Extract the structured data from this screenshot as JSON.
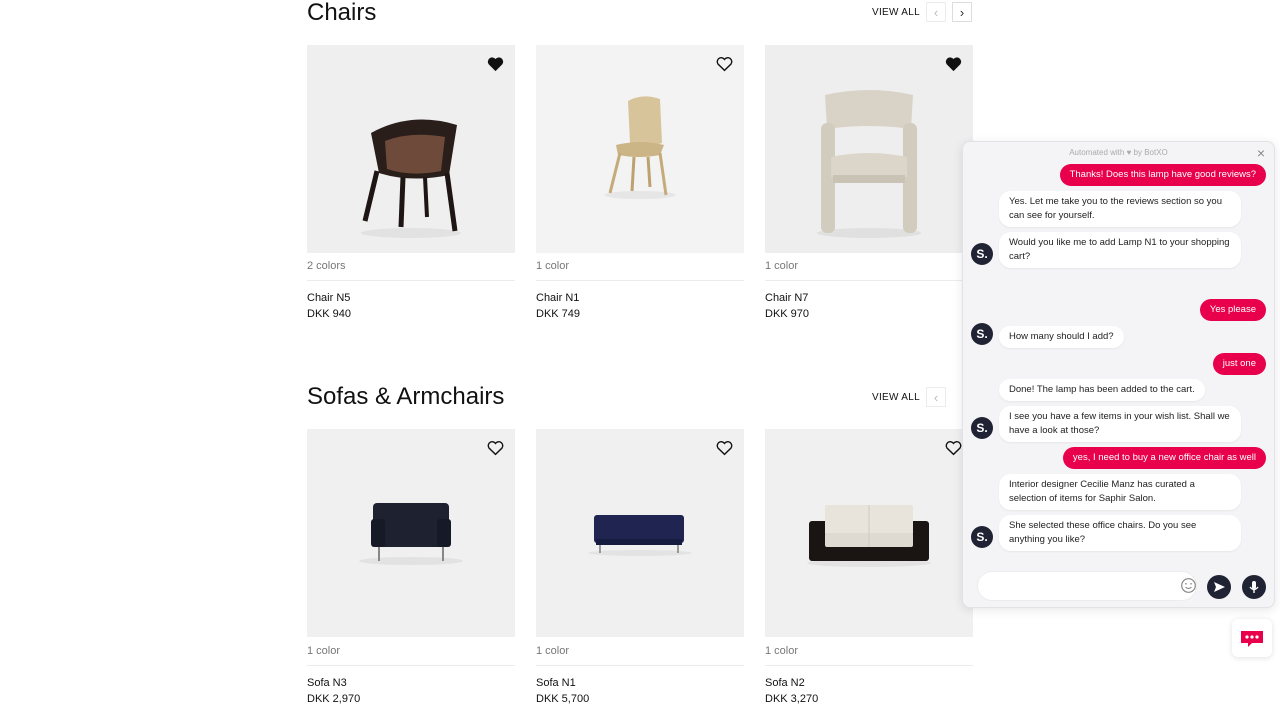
{
  "colors": {
    "accent": "#e8004d",
    "dark": "#1f2333",
    "card_bg": "#f0f0f0"
  },
  "chairs": {
    "title": "Chairs",
    "view_all": "VIEW ALL",
    "prev_icon": "chevron-left-icon",
    "next_icon": "chevron-right-icon",
    "products": [
      {
        "colors": "2 colors",
        "name": "Chair N5",
        "price": "DKK 940",
        "favorited": true
      },
      {
        "colors": "1 color",
        "name": "Chair N1",
        "price": "DKK 749",
        "favorited": false
      },
      {
        "colors": "1 color",
        "name": "Chair N7",
        "price": "DKK 970",
        "favorited": true
      }
    ]
  },
  "sofas": {
    "title": "Sofas & Armchairs",
    "view_all": "VIEW ALL",
    "products": [
      {
        "colors": "1 color",
        "name": "Sofa N3",
        "price": "DKK 2,970",
        "favorited": false
      },
      {
        "colors": "1 color",
        "name": "Sofa N1",
        "price": "DKK 5,700",
        "favorited": false
      },
      {
        "colors": "1 color",
        "name": "Sofa N2",
        "price": "DKK 3,270",
        "favorited": false
      }
    ]
  },
  "chat": {
    "header": "Automated with ♥ by BotXO",
    "avatar_letter": "S.",
    "messages": [
      {
        "from": "user",
        "text": "Thanks! Does this lamp have good reviews?"
      },
      {
        "from": "bot",
        "text": "Yes. Let me take you to the reviews section so you can see for yourself."
      },
      {
        "from": "bot",
        "text": "Would you like me to add Lamp N1 to your shopping cart?"
      },
      {
        "from": "user",
        "text": "Yes please"
      },
      {
        "from": "bot",
        "text": "How many should I add?"
      },
      {
        "from": "user",
        "text": "just one"
      },
      {
        "from": "bot",
        "text": "Done! The lamp has been added to the cart."
      },
      {
        "from": "bot",
        "text": "I see you have a few items in your wish list. Shall we have a look at those?"
      },
      {
        "from": "user",
        "text": "yes, I need to buy a new office chair as well"
      },
      {
        "from": "bot",
        "text": "Interior designer Cecilie Manz has curated a selection of items for Saphir Salon."
      },
      {
        "from": "bot",
        "text": "She selected these office chairs. Do you see anything you like?"
      }
    ],
    "input_placeholder": ""
  }
}
